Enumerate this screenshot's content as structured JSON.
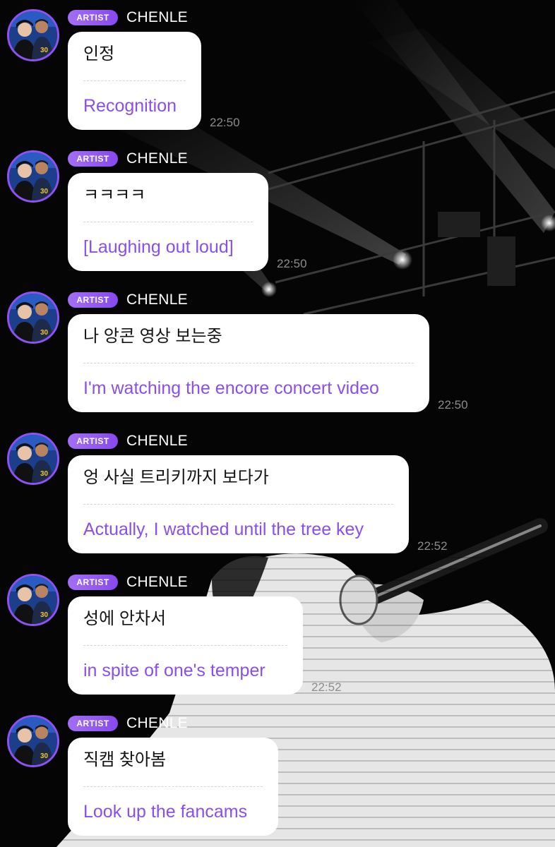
{
  "badge_label": "ARTIST",
  "colors": {
    "accent": "#8a4fe8",
    "badge": "#9b5ff4",
    "bubble": "#ffffff",
    "background": "#060606"
  },
  "avatar_icon": "profile-photo-icon",
  "messages": [
    {
      "sender": "CHENLE",
      "original": "인정",
      "translation": "Recognition",
      "time": "22:50"
    },
    {
      "sender": "CHENLE",
      "original": "ㅋㅋㅋㅋ",
      "translation": "[Laughing out loud]",
      "time": "22:50"
    },
    {
      "sender": "CHENLE",
      "original": "나 앙콘 영상 보는중",
      "translation": "I'm watching the encore concert video",
      "time": "22:50"
    },
    {
      "sender": "CHENLE",
      "original": "엉 사실 트리키까지 보다가",
      "translation": "Actually, I watched until the tree key",
      "time": "22:52"
    },
    {
      "sender": "CHENLE",
      "original": "성에 안차서",
      "translation": "in spite of one's temper",
      "time": "22:52"
    },
    {
      "sender": "CHENLE",
      "original": "직캠 찾아봄",
      "translation": "Look up the fancams",
      "time": ""
    }
  ]
}
